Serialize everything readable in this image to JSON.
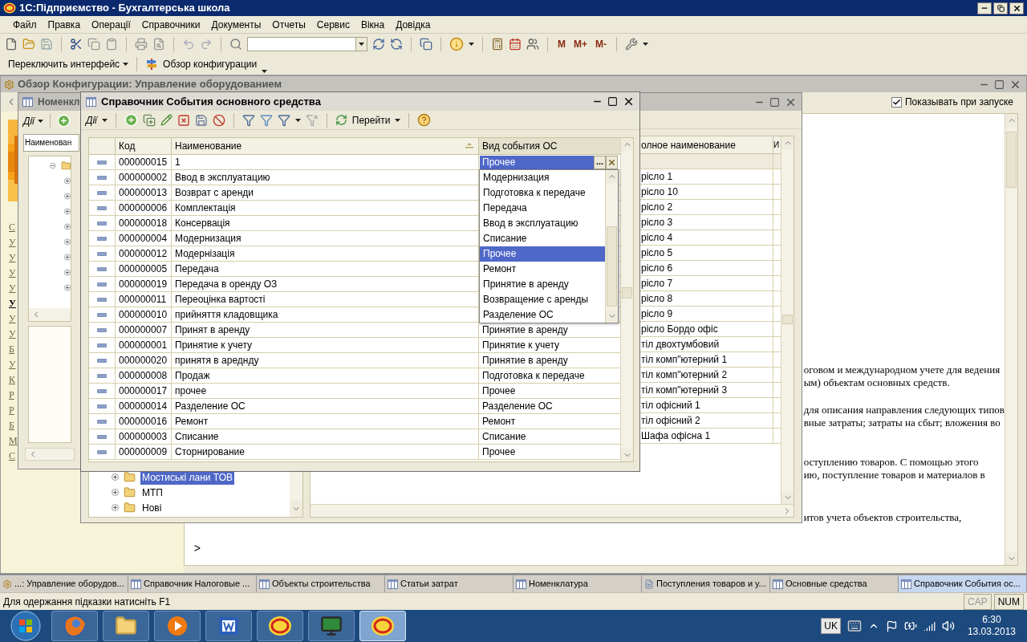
{
  "app_title": "1С:Підприємство - Бухгалтерська школа",
  "menu": [
    "Файл",
    "Правка",
    "Операції",
    "Справочники",
    "Документы",
    "Отчеты",
    "Сервис",
    "Вікна",
    "Довідка"
  ],
  "memory_buttons": [
    "M",
    "M+",
    "M-"
  ],
  "panel_bar": [
    "Переключить интерфейс",
    "Обзор конфигурации"
  ],
  "overview": {
    "title": "Обзор Конфигурации: Управление оборудованием",
    "show_on_startup": {
      "label": "Показывать при запуске",
      "checked": true
    },
    "links": [
      {
        "text": "С",
        "bold": false
      },
      {
        "text": "У",
        "bold": false
      },
      {
        "text": "У",
        "bold": false
      },
      {
        "text": "У",
        "bold": false
      },
      {
        "text": "У",
        "bold": false
      },
      {
        "text": "У",
        "bold": true
      },
      {
        "text": "У",
        "bold": false
      },
      {
        "text": "У",
        "bold": false
      },
      {
        "text": "Б",
        "bold": false
      },
      {
        "text": "У",
        "bold": false
      },
      {
        "text": "К",
        "bold": false
      },
      {
        "text": "Р",
        "bold": false
      },
      {
        "text": "Р",
        "bold": false
      },
      {
        "text": "Б",
        "bold": false
      },
      {
        "text": "М",
        "bold": false
      },
      {
        "text": "С",
        "bold": false
      }
    ],
    "paragraphs": [
      [
        "оговом и международном учете для ведения",
        "ым) объектам основных средств."
      ],
      [
        "для описания направления следующих типов",
        "вные затраты; затраты на сбыт; вложения во"
      ],
      [
        "оступлению товаров. С помощью этого",
        "ию, поступление товаров и материалов в"
      ],
      [
        "итов учета объектов строительства,"
      ]
    ],
    "prompt": ">"
  },
  "catalog": {
    "title": "Номенкл",
    "actions": "Дії",
    "filter": {
      "value": "Наименован"
    },
    "tree": [
      {
        "expanded": true,
        "children": [
          {
            "expanded": false
          },
          {
            "expanded": false
          },
          {
            "expanded": false
          },
          {
            "expanded": false
          },
          {
            "expanded": false
          },
          {
            "expanded": false
          },
          {
            "expanded": false
          },
          {
            "expanded": false
          }
        ]
      }
    ]
  },
  "list_window": {
    "columns": [
      "олное наименование",
      "И"
    ],
    "rows": [
      {
        "name": "",
        "selected": true
      },
      {
        "name": "рісло 1",
        "selected": false
      },
      {
        "name": "рісло 10",
        "selected": false
      },
      {
        "name": "рісло 2",
        "selected": false
      },
      {
        "name": "рісло 3",
        "selected": false
      },
      {
        "name": "рісло 4",
        "selected": false
      },
      {
        "name": "рісло 5",
        "selected": false
      },
      {
        "name": "рісло 6",
        "selected": false
      },
      {
        "name": "рісло 7",
        "selected": false
      },
      {
        "name": "рісло 8",
        "selected": false
      },
      {
        "name": "рісло 9",
        "selected": false
      },
      {
        "name": "рісло Бордо офіс",
        "selected": false
      },
      {
        "name": "тіл двохтумбовий",
        "selected": false
      },
      {
        "name": "тіл комп\"ютерний 1",
        "selected": false
      },
      {
        "name": "тіл комп\"ютерний 2",
        "selected": false
      },
      {
        "name": "тіл комп\"ютерний 3",
        "selected": false
      },
      {
        "name": "тіл офісний 1",
        "selected": false
      },
      {
        "name": "тіл офісний 2",
        "selected": false
      },
      {
        "name": "Шафа офісна 1",
        "selected": false
      }
    ],
    "tree": [
      {
        "label": "Мостиські лани ТОВ",
        "selected": true
      },
      {
        "label": "МТП",
        "selected": false
      },
      {
        "label": "Нові",
        "selected": false
      }
    ]
  },
  "dialog": {
    "title": "Справочник События основного средства",
    "actions": "Дії",
    "goto": "Перейти",
    "choose_label": "...",
    "columns": [
      "Код",
      "Наименование",
      "Вид события ОС"
    ],
    "rows": [
      {
        "code": "000000015",
        "name": "1",
        "editor": {
          "value": "Прочее"
        }
      },
      {
        "code": "000000002",
        "name": "Ввод в эксплуатацию"
      },
      {
        "code": "000000013",
        "name": "Возврат с аренди"
      },
      {
        "code": "000000006",
        "name": "Комплектація"
      },
      {
        "code": "000000018",
        "name": "Консервація"
      },
      {
        "code": "000000004",
        "name": "Модернизация"
      },
      {
        "code": "000000012",
        "name": "Модернізація"
      },
      {
        "code": "000000005",
        "name": "Передача"
      },
      {
        "code": "000000019",
        "name": "Передача в оренду ОЗ"
      },
      {
        "code": "000000011",
        "name": "Переоцінка вартості"
      },
      {
        "code": "000000010",
        "name": "прийняття кладовщика"
      },
      {
        "code": "000000007",
        "name": "Принят в аренду",
        "event_type": "Принятие в аренду"
      },
      {
        "code": "000000001",
        "name": "Принятие к учету",
        "event_type": "Принятие к учету"
      },
      {
        "code": "000000020",
        "name": "принятя в ареднду",
        "event_type": "Принятие в аренду"
      },
      {
        "code": "000000008",
        "name": "Продаж",
        "event_type": "Подготовка к передаче"
      },
      {
        "code": "000000017",
        "name": "прочее",
        "event_type": "Прочее"
      },
      {
        "code": "000000014",
        "name": "Разделение ОС",
        "event_type": "Разделение ОС"
      },
      {
        "code": "000000016",
        "name": "Ремонт",
        "event_type": "Ремонт"
      },
      {
        "code": "000000003",
        "name": "Списание",
        "event_type": "Списание"
      },
      {
        "code": "000000009",
        "name": "Сторнирование",
        "event_type": "Прочее"
      }
    ],
    "dropdown": [
      {
        "label": "Модернизация",
        "selected": false
      },
      {
        "label": "Подготовка к передаче",
        "selected": false
      },
      {
        "label": "Передача",
        "selected": false
      },
      {
        "label": "Ввод в эксплуатацию",
        "selected": false
      },
      {
        "label": "Списание",
        "selected": false
      },
      {
        "label": "Прочее",
        "selected": true
      },
      {
        "label": "Ремонт",
        "selected": false
      },
      {
        "label": "Принятие в аренду",
        "selected": false
      },
      {
        "label": "Возвращение с аренды",
        "selected": false
      },
      {
        "label": "Разделение ОС",
        "selected": false
      }
    ]
  },
  "window_tabs": [
    {
      "label": "...: Управление оборудов...",
      "kind": "config",
      "selected": false
    },
    {
      "label": "Справочник Налоговые ...",
      "kind": "table",
      "selected": false
    },
    {
      "label": "Объекты строительства",
      "kind": "table",
      "selected": false
    },
    {
      "label": "Статьи затрат",
      "kind": "table",
      "selected": false
    },
    {
      "label": "Номенклатура",
      "kind": "table",
      "selected": false
    },
    {
      "label": "Поступления товаров и у...",
      "kind": "document",
      "selected": false
    },
    {
      "label": "Основные средства",
      "kind": "table",
      "selected": false
    },
    {
      "label": "Справочник События ос...",
      "kind": "table",
      "selected": true
    }
  ],
  "status": {
    "hint": "Для одержання підказки натисніть F1",
    "indicators": [
      "CAP",
      "NUM"
    ]
  },
  "taskbar": {
    "apps": [
      {
        "kind": "browser",
        "active": false
      },
      {
        "kind": "folder",
        "active": false
      },
      {
        "kind": "media",
        "active": false
      },
      {
        "kind": "word",
        "active": false
      },
      {
        "kind": "onec",
        "active": false
      },
      {
        "kind": "monitor",
        "active": false
      },
      {
        "kind": "onec",
        "active": true
      }
    ],
    "language": "UK",
    "time": "6:30",
    "date": "13.03.2013"
  }
}
